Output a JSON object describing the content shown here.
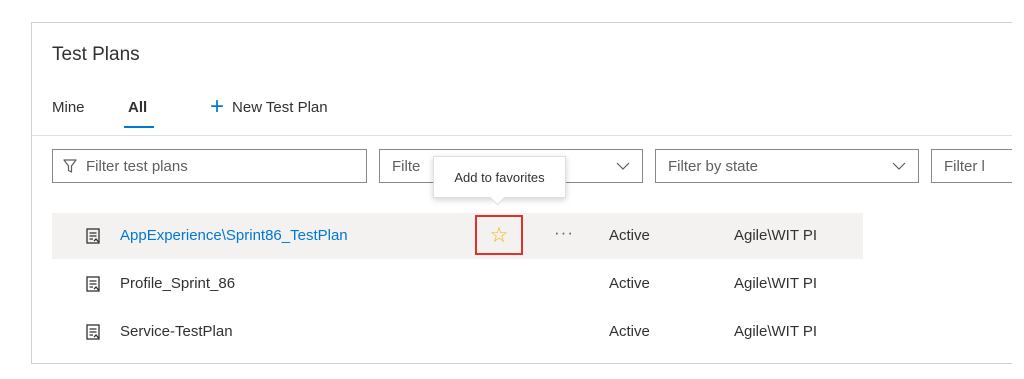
{
  "page": {
    "title": "Test Plans",
    "tabs": [
      {
        "label": "Mine"
      },
      {
        "label": "All"
      }
    ],
    "new_plan_label": "New Test Plan"
  },
  "filters": {
    "plans_placeholder": "Filter test plans",
    "second_placeholder": "Filte",
    "state_placeholder": "Filter by state",
    "fourth_placeholder": "Filter l"
  },
  "tooltip": "Add to favorites",
  "more_label": "···",
  "favorite_glyph": "☆",
  "rows": [
    {
      "name": "AppExperience\\Sprint86_TestPlan",
      "state": "Active",
      "area": "Agile\\WIT PI"
    },
    {
      "name": "Profile_Sprint_86",
      "state": "Active",
      "area": "Agile\\WIT PI"
    },
    {
      "name": "Service-TestPlan",
      "state": "Active",
      "area": "Agile\\WIT PI"
    }
  ],
  "colors": {
    "accent": "#0078d4",
    "highlight_border": "#e0312a",
    "star": "#f2b600",
    "selected_row": "#f3f2f1"
  },
  "icons": {
    "filter": "filter-funnel-icon",
    "chevron": "chevron-down-icon",
    "plus": "plus-icon",
    "test_plan": "test-plan-icon",
    "favorite": "star-outline-icon",
    "more": "more-actions-icon"
  }
}
